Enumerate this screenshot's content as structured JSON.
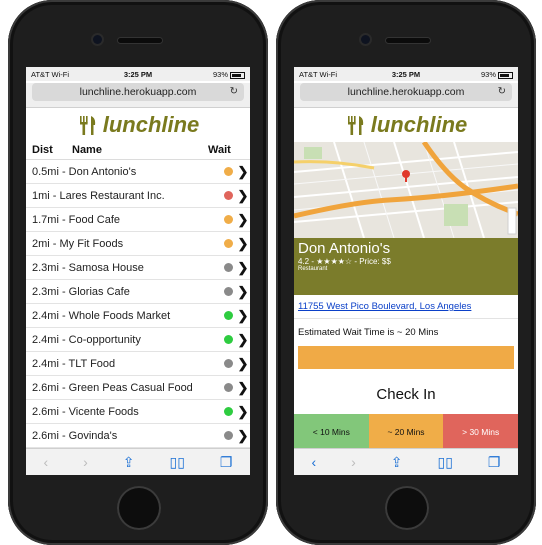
{
  "status": {
    "carrier": "AT&T Wi-Fi",
    "time": "3:25 PM",
    "battery": "93%"
  },
  "url": "lunchline.herokuapp.com",
  "app": {
    "name": "lunchline"
  },
  "list": {
    "headers": {
      "dist": "Dist",
      "name": "Name",
      "wait": "Wait"
    },
    "rows": [
      {
        "label": "0.5mi - Don Antonio's",
        "wait_color": "#f0ad48"
      },
      {
        "label": "1mi - Lares Restaurant Inc.",
        "wait_color": "#e0655c"
      },
      {
        "label": "1.7mi - Food Cafe",
        "wait_color": "#f0ad48"
      },
      {
        "label": "2mi - My Fit Foods",
        "wait_color": "#f0ad48"
      },
      {
        "label": "2.3mi - Samosa House",
        "wait_color": "#8a8a8a"
      },
      {
        "label": "2.3mi - Glorias Cafe",
        "wait_color": "#8a8a8a"
      },
      {
        "label": "2.4mi - Whole Foods Market",
        "wait_color": "#2ecc40"
      },
      {
        "label": "2.4mi - Co-opportunity",
        "wait_color": "#2ecc40"
      },
      {
        "label": "2.4mi - TLT Food",
        "wait_color": "#8a8a8a"
      },
      {
        "label": "2.6mi - Green Peas Casual Food",
        "wait_color": "#8a8a8a"
      },
      {
        "label": "2.6mi - Vicente Foods",
        "wait_color": "#2ecc40"
      },
      {
        "label": "2.6mi - Govinda's",
        "wait_color": "#8a8a8a"
      }
    ]
  },
  "detail": {
    "name": "Don Antonio's",
    "rating_price": "4.2 - ★★★★☆ - Price: $$",
    "category": "Restaurant",
    "address": "11755 West Pico Boulevard, Los Angeles",
    "wait_text": "Estimated Wait Time is ~ 20 Mins",
    "wait_level": 20,
    "checkin_title": "Check In",
    "checkin_options": [
      {
        "label": "< 10 Mins",
        "color": "#82c77a"
      },
      {
        "label": "~ 20 Mins",
        "color": "#f0ad48"
      },
      {
        "label": "> 30 Mins",
        "color": "#e0655c"
      }
    ]
  },
  "colors": {
    "brand": "#7a7a1e",
    "banner": "#7b7c2b",
    "link": "#0b40c8",
    "wait_bar": "#f0aa46"
  }
}
